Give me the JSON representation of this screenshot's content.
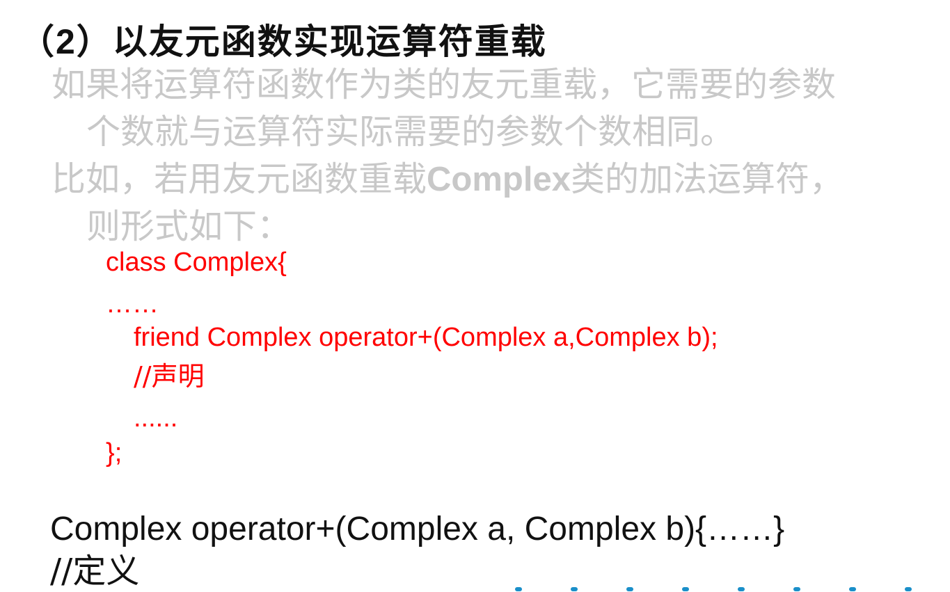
{
  "heading": "（2）以友元函数实现运算符重载",
  "paragraph1": {
    "line1": "如果将运算符函数作为类的友元重载，它需要的参数",
    "line2": "个数就与运算符实际需要的参数个数相同。"
  },
  "paragraph2": {
    "line1_prefix": "比如，若用友元函数重载",
    "line1_class": "Complex",
    "line1_suffix": "类的加法运算符，",
    "line2": "则形式如下："
  },
  "code": {
    "line1": "class Complex{",
    "line2": "……",
    "line3": "friend Complex operator+(Complex a,Complex b);",
    "line4": "//声明",
    "line5": "......",
    "line6": "};"
  },
  "definition": {
    "line1": "Complex  operator+(Complex a, Complex b){……}",
    "line2": "//定义"
  },
  "colors": {
    "heading": "#111111",
    "paragraph": "#c8c8c8",
    "code": "#ff0000",
    "definition": "#111111",
    "decoration_dots": "#1a8fc9"
  }
}
